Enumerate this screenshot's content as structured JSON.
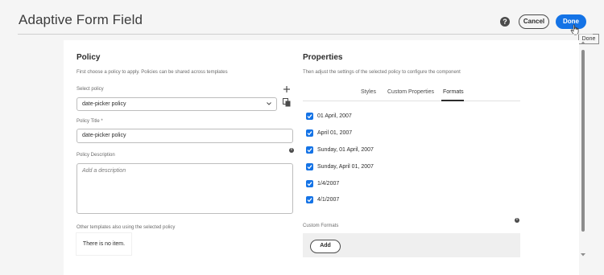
{
  "header": {
    "title": "Adaptive Form Field",
    "help_icon": "help-icon",
    "help_glyph": "?",
    "cancel_label": "Cancel",
    "done_label": "Done",
    "tooltip": "Done"
  },
  "policy": {
    "heading": "Policy",
    "description": "First choose a policy to apply. Policies can be shared across templates",
    "select_label": "Select policy",
    "selected_policy": "date-picker policy",
    "title_label": "Policy Title *",
    "title_value": "date-picker policy",
    "description_label": "Policy Description",
    "description_placeholder": "Add a description",
    "other_templates_label": "Other templates also using the selected policy",
    "no_item_text": "There is no item."
  },
  "properties": {
    "heading": "Properties",
    "description": "Then adjust the settings of the selected policy to configure the component",
    "tabs": [
      {
        "label": "Styles",
        "active": false
      },
      {
        "label": "Custom Properties",
        "active": false
      },
      {
        "label": "Formats",
        "active": true
      }
    ],
    "formats": [
      {
        "label": "01 April, 2007",
        "checked": true
      },
      {
        "label": "April 01, 2007",
        "checked": true
      },
      {
        "label": "Sunday, 01 April, 2007",
        "checked": true
      },
      {
        "label": "Sunday, April 01, 2007",
        "checked": true
      },
      {
        "label": "1/4/2007",
        "checked": true
      },
      {
        "label": "4/1/2007",
        "checked": true
      }
    ],
    "custom_formats_label": "Custom Formats",
    "add_label": "Add"
  },
  "icons": {
    "info_glyph": "i"
  },
  "colors": {
    "accent": "#1473e6",
    "background": "#f5f5f5",
    "panel": "#ffffff"
  }
}
